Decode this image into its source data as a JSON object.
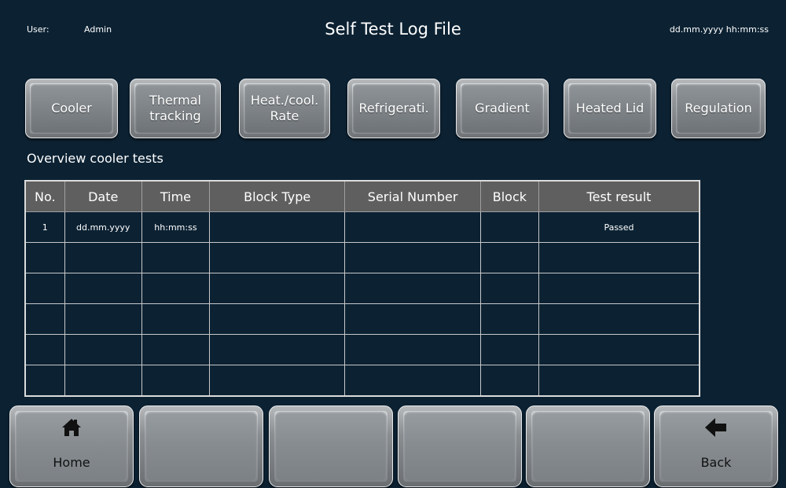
{
  "header": {
    "user_label": "User:",
    "user_name": "Admin",
    "title": "Self Test Log File",
    "datetime": "dd.mm.yyyy  hh:mm:ss"
  },
  "tabs": [
    {
      "label": "Cooler"
    },
    {
      "label": "Thermal\ntracking"
    },
    {
      "label": "Heat./cool.\nRate"
    },
    {
      "label": "Refrigerati."
    },
    {
      "label": "Gradient"
    },
    {
      "label": "Heated Lid"
    },
    {
      "label": "Regulation"
    }
  ],
  "section": {
    "title": "Overview cooler tests"
  },
  "table": {
    "columns": [
      "No.",
      "Date",
      "Time",
      "Block Type",
      "Serial Number",
      "Block",
      "Test result"
    ],
    "rows": [
      [
        "1",
        "dd.mm.yyyy",
        "hh:mm:ss",
        "",
        "",
        "",
        "Passed"
      ],
      [
        "",
        "",
        "",
        "",
        "",
        "",
        ""
      ],
      [
        "",
        "",
        "",
        "",
        "",
        "",
        ""
      ],
      [
        "",
        "",
        "",
        "",
        "",
        "",
        ""
      ],
      [
        "",
        "",
        "",
        "",
        "",
        "",
        ""
      ],
      [
        "",
        "",
        "",
        "",
        "",
        "",
        ""
      ]
    ]
  },
  "bottom": {
    "home_label": "Home",
    "home_icon": "home-icon",
    "back_label": "Back",
    "back_icon": "arrow-left-icon"
  },
  "colors": {
    "background": "#0c2233",
    "table_header": "#5f5f5f",
    "button_face": "#8f9498"
  }
}
